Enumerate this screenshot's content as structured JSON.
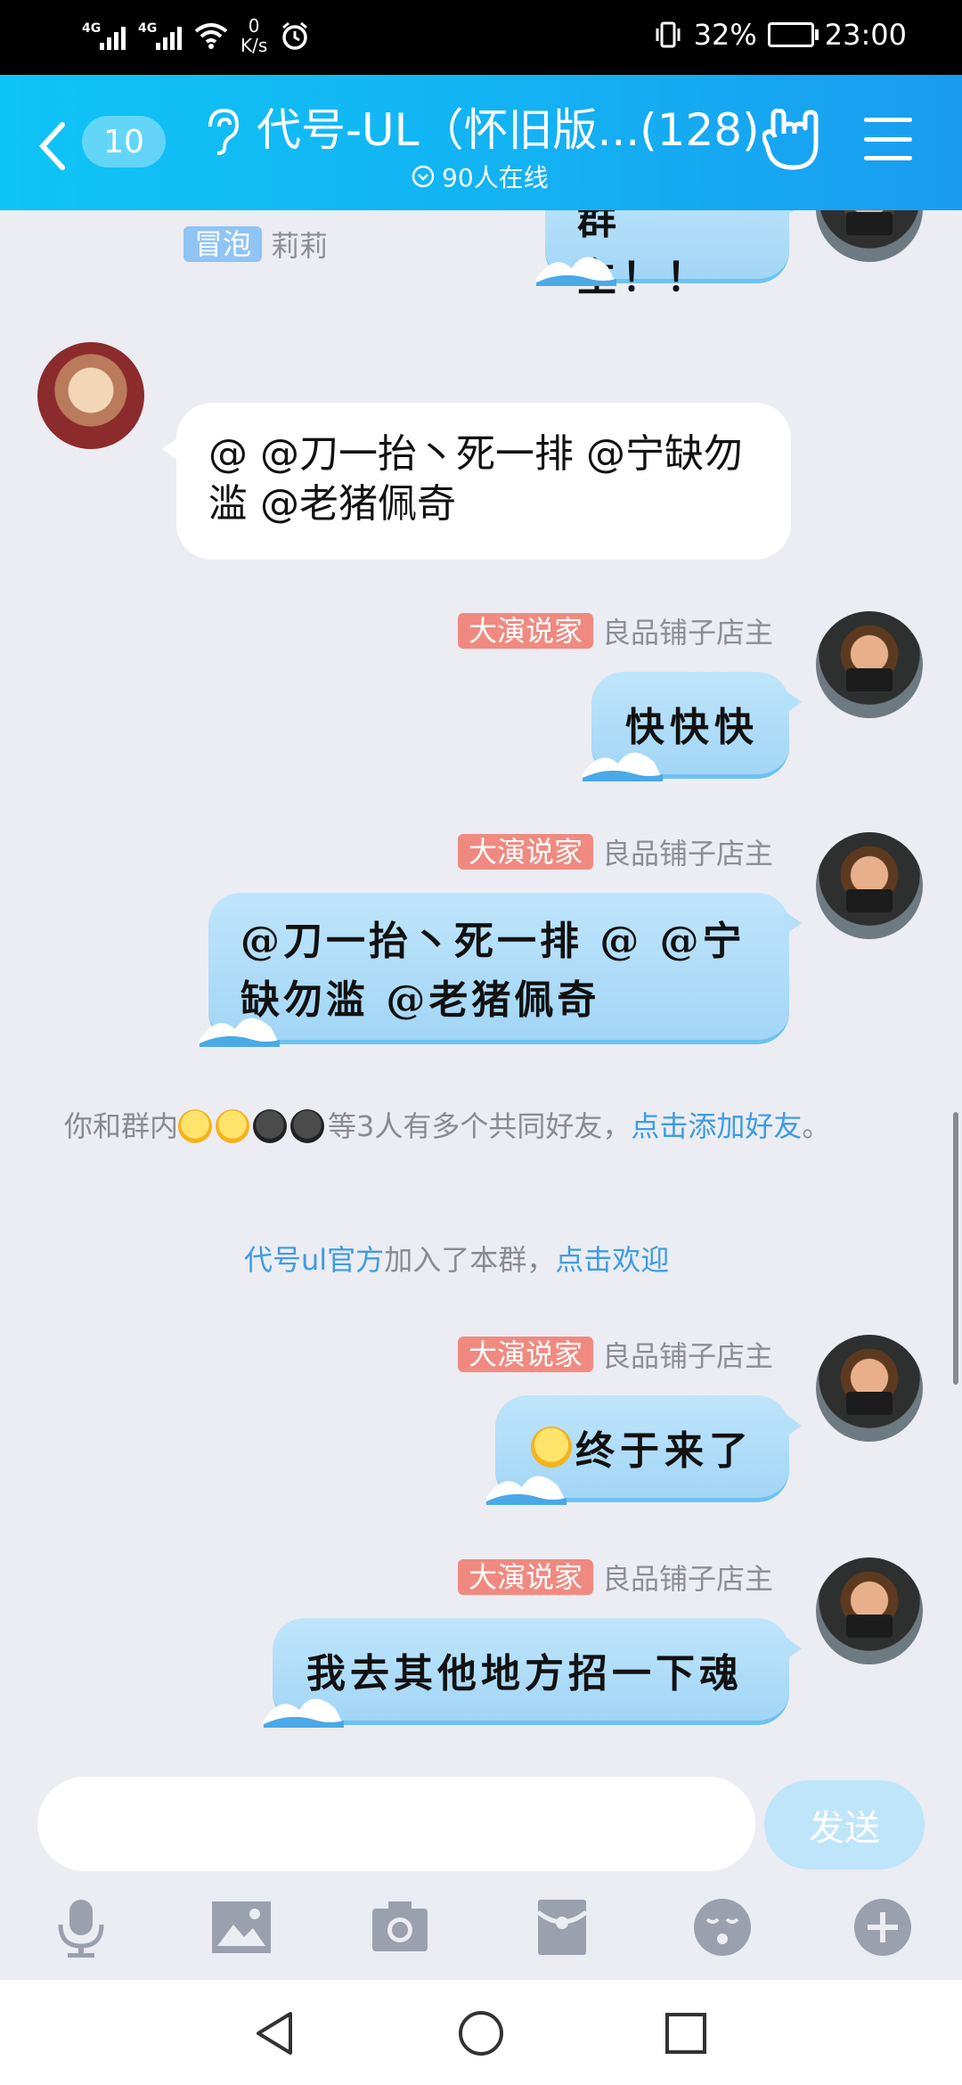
{
  "status_bar": {
    "signal1_tag": "4G",
    "signal2_tag": "4G",
    "net_speed_value": "0",
    "net_speed_unit": "K/s",
    "battery": "32%",
    "time": "23:00"
  },
  "header": {
    "unread_count": "10",
    "title": "代号-UL（怀旧版...(128)",
    "online": "90人在线"
  },
  "messages": {
    "top_partial": "群主！！",
    "m1": {
      "badge": "冒泡",
      "name": "莉莉",
      "text": "@ @刀一抬丶死一排 @宁缺勿滥 @老猪佩奇"
    },
    "m2": {
      "badge": "大演说家",
      "name": "良品铺子店主",
      "text": "快快快"
    },
    "m3": {
      "badge": "大演说家",
      "name": "良品铺子店主",
      "text": "@刀一抬丶死一排 @ @宁缺勿滥 @老猪佩奇"
    },
    "m4": {
      "badge": "大演说家",
      "name": "良品铺子店主",
      "text": "终于来了"
    },
    "m5": {
      "badge": "大演说家",
      "name": "良品铺子店主",
      "text": "我去其他地方招一下魂"
    }
  },
  "system": {
    "friends_prefix": "你和群内",
    "friends_suffix": "等3人有多个共同好友，",
    "friends_link": "点击添加好友",
    "friends_end": "。",
    "join_name": "代号ul官方",
    "join_text": "加入了本群，",
    "join_link": "点击欢迎"
  },
  "input": {
    "placeholder": "",
    "send_label": "发送"
  },
  "toolbar_icons": [
    "microphone-icon",
    "image-icon",
    "camera-icon",
    "red-packet-icon",
    "emoji-icon",
    "plus-icon"
  ],
  "colors": {
    "header_gradient_start": "#0fc4f6",
    "header_gradient_end": "#1a9cf0",
    "badge_blue": "#8fc4f5",
    "badge_red": "#f08a80",
    "link": "#3d9ce3",
    "wave_bubble": "#a2d6f6"
  }
}
